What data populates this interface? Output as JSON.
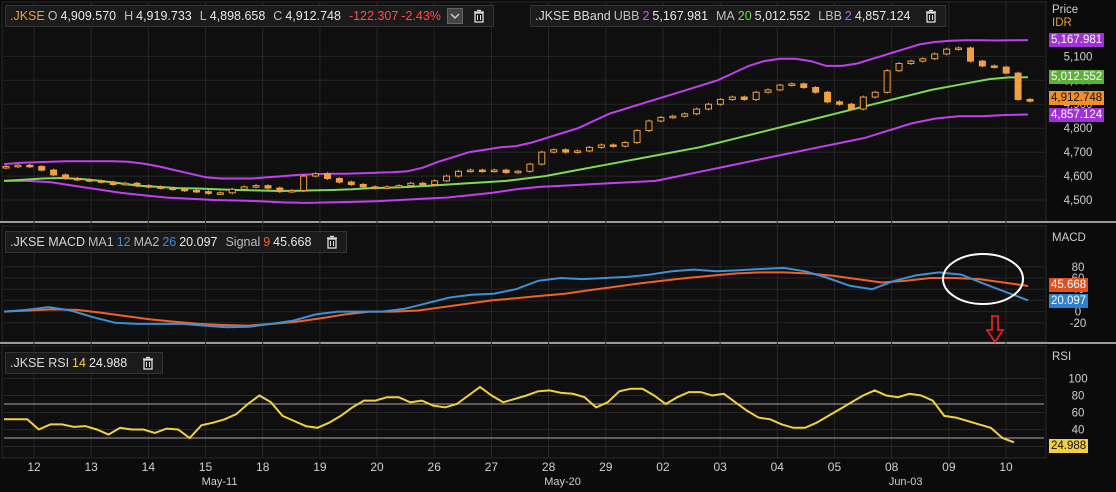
{
  "price_header": {
    "symbol": ".JKSE",
    "open_label": "O",
    "open": "4,909.570",
    "high_label": "H",
    "high": "4,919.733",
    "low_label": "L",
    "low": "4,898.658",
    "close_label": "C",
    "close": "4,912.748",
    "change": "-122.307",
    "change_pct": "-2.43%"
  },
  "bband_header": {
    "symbol": ".JKSE BBand",
    "ubb_label": "UBB",
    "ubb_n": "2",
    "ubb": "5,167.981",
    "ma_label": "MA",
    "ma_n": "20",
    "ma": "5,012.552",
    "lbb_label": "LBB",
    "lbb_n": "2",
    "lbb": "4,857.124"
  },
  "macd_header": {
    "symbol": ".JKSE MACD",
    "ma1_label": "MA1",
    "ma1_n": "12",
    "ma2_label": "MA2",
    "ma2_n": "26",
    "macd": "20.097",
    "signal_label": "Signal",
    "signal_n": "9",
    "signal": "45.668"
  },
  "rsi_header": {
    "symbol": ".JKSE RSI",
    "n": "14",
    "value": "24.988"
  },
  "axis_titles": {
    "price": "Price",
    "currency": "IDR",
    "macd": "MACD",
    "rsi": "RSI"
  },
  "price_tags": {
    "ubb": "5,167.981",
    "ma": "5,012.552",
    "close": "4,912.748",
    "lbb": "4,857.124"
  },
  "macd_tags": {
    "signal": "45.668",
    "macd": "20.097"
  },
  "rsi_tag": "24.988",
  "colors": {
    "ubb": "#c040f0",
    "ma": "#7ed957",
    "up": "#f0a040",
    "down": "#f0a040",
    "macd": "#3f8fd8",
    "signal": "#f0602a",
    "rsi": "#f0d040"
  },
  "chart_data": [
    {
      "type": "candlestick",
      "title": "",
      "ylabel": "Price IDR",
      "ylim": [
        4450,
        5210
      ],
      "yticks": [
        4500,
        4600,
        4700,
        4800,
        4900,
        5000,
        5100
      ],
      "ytick_labels": [
        "4,500",
        "4,600",
        "4,700",
        "4,800",
        "4,900",
        "5,000",
        "5,100"
      ],
      "x_ticks": [
        "12",
        "13",
        "14",
        "15",
        "18",
        "19",
        "20",
        "26",
        "27",
        "28",
        "29",
        "02",
        "03",
        "04",
        "05",
        "08",
        "09",
        "10"
      ],
      "month_labels": [
        {
          "label": "May-11",
          "at": "15"
        },
        {
          "label": "May-20",
          "at": "28"
        },
        {
          "label": "Jun-03",
          "at": "08"
        }
      ],
      "close": [
        4640,
        4645,
        4640,
        4625,
        4605,
        4590,
        4585,
        4580,
        4575,
        4565,
        4570,
        4560,
        4555,
        4550,
        4545,
        4540,
        4535,
        4528,
        4530,
        4545,
        4555,
        4560,
        4550,
        4535,
        4540,
        4600,
        4610,
        4590,
        4575,
        4565,
        4555,
        4550,
        4555,
        4560,
        4570,
        4565,
        4580,
        4600,
        4620,
        4625,
        4620,
        4625,
        4615,
        4620,
        4650,
        4700,
        4710,
        4700,
        4705,
        4720,
        4730,
        4725,
        4740,
        4790,
        4830,
        4845,
        4850,
        4860,
        4880,
        4900,
        4920,
        4930,
        4920,
        4950,
        4960,
        4980,
        4985,
        4970,
        4950,
        4910,
        4900,
        4880,
        4930,
        4950,
        5040,
        5070,
        5080,
        5090,
        5110,
        5130,
        5135,
        5080,
        5060,
        5055,
        5030,
        4920,
        4912.748
      ],
      "bollinger_upper": [
        4650,
        4655,
        4658,
        4660,
        4662,
        4662,
        4662,
        4662,
        4660,
        4652,
        4640,
        4625,
        4610,
        4595,
        4590,
        4590,
        4590,
        4595,
        4600,
        4605,
        4608,
        4610,
        4610,
        4612,
        4614,
        4616,
        4620,
        4635,
        4660,
        4680,
        4700,
        4710,
        4720,
        4725,
        4740,
        4760,
        4780,
        4800,
        4830,
        4860,
        4880,
        4900,
        4920,
        4940,
        4960,
        4980,
        5000,
        5030,
        5060,
        5080,
        5090,
        5090,
        5080,
        5060,
        5060,
        5070,
        5090,
        5110,
        5130,
        5150,
        5160,
        5165,
        5167,
        5167,
        5166,
        5167,
        5167.981
      ],
      "ma20": [
        4580,
        4585,
        4590,
        4592,
        4588,
        4580,
        4570,
        4560,
        4555,
        4550,
        4548,
        4545,
        4542,
        4540,
        4538,
        4538,
        4540,
        4542,
        4545,
        4550,
        4552,
        4555,
        4560,
        4565,
        4570,
        4575,
        4580,
        4590,
        4600,
        4615,
        4630,
        4645,
        4660,
        4675,
        4690,
        4705,
        4720,
        4740,
        4760,
        4780,
        4800,
        4820,
        4840,
        4860,
        4880,
        4900,
        4920,
        4940,
        4960,
        4975,
        4990,
        5005,
        5012,
        5012.552
      ],
      "bollinger_lower": [
        4580,
        4580,
        4575,
        4560,
        4545,
        4530,
        4520,
        4510,
        4505,
        4500,
        4498,
        4495,
        4490,
        4488,
        4490,
        4492,
        4495,
        4500,
        4505,
        4510,
        4520,
        4530,
        4545,
        4555,
        4560,
        4565,
        4570,
        4575,
        4580,
        4600,
        4620,
        4640,
        4660,
        4680,
        4700,
        4720,
        4740,
        4760,
        4790,
        4820,
        4840,
        4850,
        4850,
        4855,
        4857.124
      ]
    },
    {
      "type": "line",
      "title": "",
      "ylabel": "MACD",
      "ylim": [
        -40,
        110
      ],
      "yticks": [
        -20,
        0,
        20,
        40,
        60,
        80
      ],
      "series": [
        {
          "name": "MA1 12 MA2 26",
          "values": [
            0,
            3,
            8,
            2,
            -10,
            -20,
            -22,
            -22,
            -22,
            -25,
            -28,
            -27,
            -22,
            -16,
            -5,
            0,
            0,
            0,
            5,
            15,
            25,
            30,
            32,
            40,
            55,
            60,
            58,
            60,
            62,
            66,
            72,
            75,
            72,
            74,
            76,
            78,
            72,
            60,
            46,
            40,
            55,
            65,
            70,
            66,
            50,
            35,
            20.097
          ]
        },
        {
          "name": "Signal 9",
          "values": [
            0,
            2,
            4,
            3,
            -2,
            -8,
            -14,
            -18,
            -22,
            -24,
            -25,
            -22,
            -18,
            -12,
            -5,
            0,
            0,
            2,
            8,
            14,
            20,
            24,
            28,
            32,
            38,
            44,
            50,
            55,
            60,
            64,
            68,
            70,
            70,
            68,
            64,
            58,
            52,
            55,
            60,
            60,
            58,
            52,
            45.668
          ]
        }
      ]
    },
    {
      "type": "line",
      "title": "",
      "ylabel": "RSI",
      "ylim": [
        10,
        110
      ],
      "yticks": [
        20,
        40,
        60,
        80,
        100
      ],
      "reference_lines": [
        30,
        70
      ],
      "series": [
        {
          "name": "RSI 14",
          "values": [
            52,
            52,
            52,
            40,
            46,
            46,
            43,
            44,
            40,
            34,
            42,
            40,
            40,
            36,
            41,
            40,
            30,
            45,
            48,
            52,
            58,
            70,
            80,
            72,
            56,
            50,
            44,
            42,
            48,
            56,
            66,
            74,
            74,
            78,
            78,
            72,
            74,
            68,
            66,
            70,
            80,
            90,
            80,
            72,
            76,
            80,
            85,
            86,
            83,
            82,
            78,
            66,
            72,
            85,
            88,
            88,
            80,
            70,
            78,
            84,
            84,
            80,
            82,
            72,
            62,
            54,
            52,
            46,
            42,
            42,
            48,
            56,
            64,
            72,
            80,
            86,
            80,
            78,
            82,
            80,
            74,
            56,
            54,
            50,
            46,
            42,
            30,
            24.988
          ]
        }
      ]
    }
  ]
}
